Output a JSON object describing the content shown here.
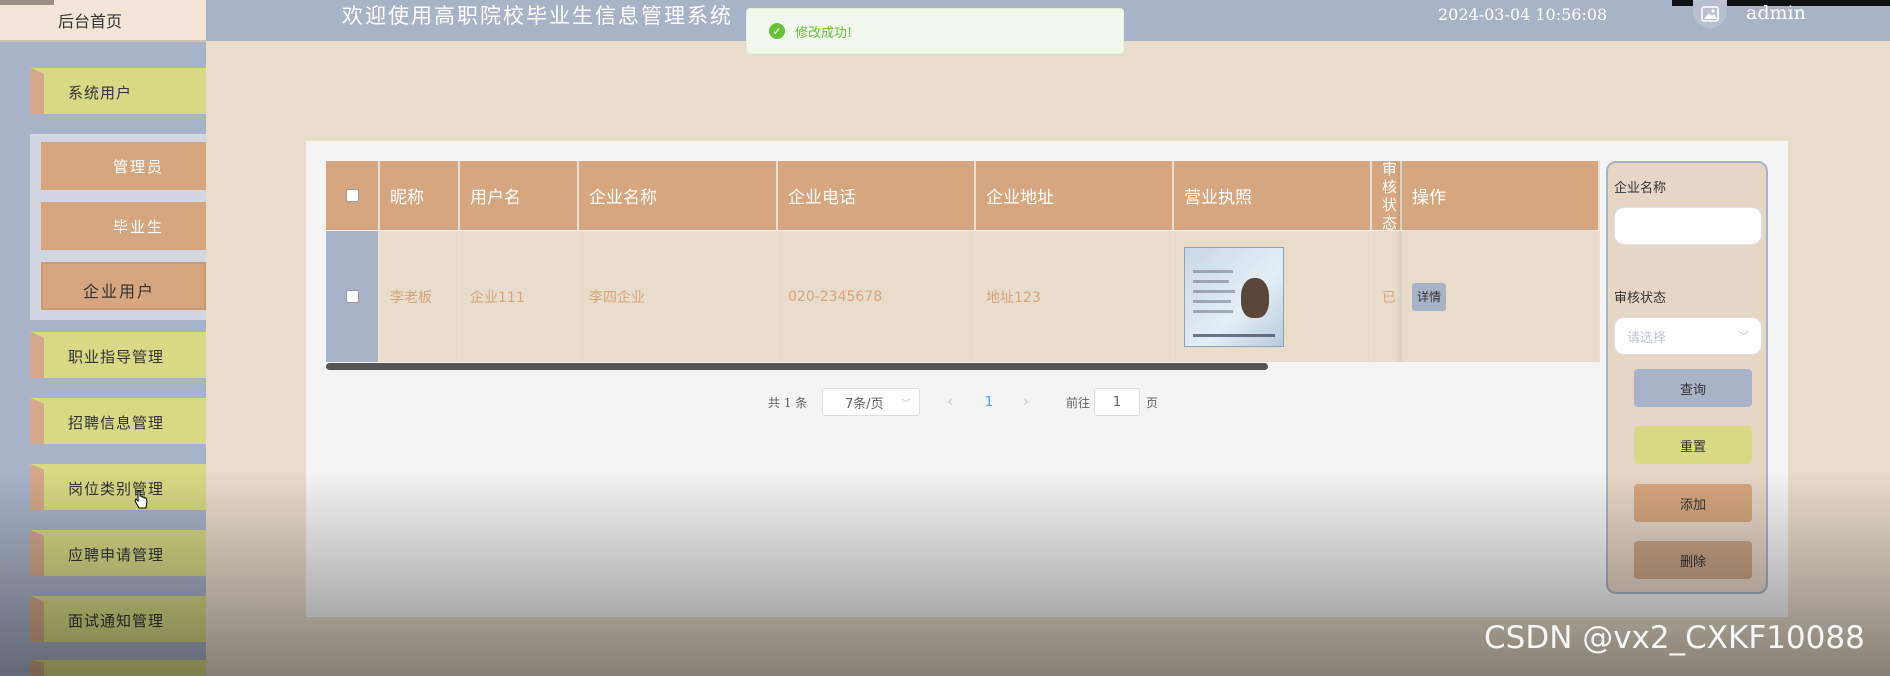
{
  "header": {
    "home_label": "后台首页",
    "site_title": "欢迎使用高职院校毕业生信息管理系统",
    "datetime": "2024-03-04 10:56:08",
    "username": "admin"
  },
  "toast": {
    "message": "修改成功!",
    "color": "#67c23a"
  },
  "sidebar": {
    "items": [
      {
        "label": "系统用户"
      },
      {
        "label": "职业指导管理"
      },
      {
        "label": "招聘信息管理"
      },
      {
        "label": "岗位类别管理"
      },
      {
        "label": "应聘申请管理"
      },
      {
        "label": "面试通知管理"
      }
    ],
    "submenu": [
      {
        "label": "管理员"
      },
      {
        "label": "毕业生"
      },
      {
        "label": "企业用户"
      }
    ]
  },
  "table": {
    "headers": [
      "昵称",
      "用户名",
      "企业名称",
      "企业电话",
      "企业地址",
      "营业执照",
      "审核状态",
      "操作"
    ],
    "rows": [
      {
        "nickname": "李老板",
        "username": "企业111",
        "company": "李四企业",
        "phone": "020-2345678",
        "address": "地址123",
        "status": "已",
        "action": "详情"
      }
    ]
  },
  "pagination": {
    "total_text": "共 1 条",
    "page_size": "7条/页",
    "current_page": "1",
    "goto_label": "前往",
    "goto_value": "1",
    "page_suffix": "页"
  },
  "search": {
    "company_label": "企业名称",
    "status_label": "审核状态",
    "status_placeholder": "请选择",
    "query_button": "查询",
    "reset_button": "重置",
    "add_button": "添加",
    "delete_button": "删除"
  },
  "watermark": "CSDN @vx2_CXKF10088",
  "colors": {
    "header": "#a9b3c7",
    "menu_item": "#d7d984",
    "sub_item": "#d5a67f",
    "table_header": "#d5a67f",
    "cell_text": "#d7a57a"
  }
}
